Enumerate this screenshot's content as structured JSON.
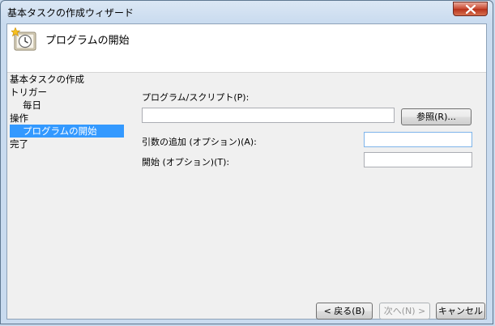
{
  "window": {
    "title": "基本タスクの作成ウィザード"
  },
  "header": {
    "title": "プログラムの開始",
    "icon": "scheduled-task-clock-icon"
  },
  "steps": [
    {
      "label": "基本タスクの作成"
    },
    {
      "label": "トリガー"
    },
    {
      "label": "毎日"
    },
    {
      "label": "操作"
    },
    {
      "label": "プログラムの開始"
    },
    {
      "label": "完了"
    }
  ],
  "form": {
    "program_label": "プログラム/スクリプト(P):",
    "program_value": "",
    "browse_label": "参照(R)...",
    "args_label": "引数の追加 (オプション)(A):",
    "args_value": "",
    "start_in_label": "開始 (オプション)(T):",
    "start_in_value": ""
  },
  "footer": {
    "back_label": "< 戻る(B)",
    "next_label": "次へ(N) >",
    "cancel_label": "キャンセル"
  },
  "colors": {
    "selection": "#3399ff",
    "close_button": "#c8472f"
  }
}
